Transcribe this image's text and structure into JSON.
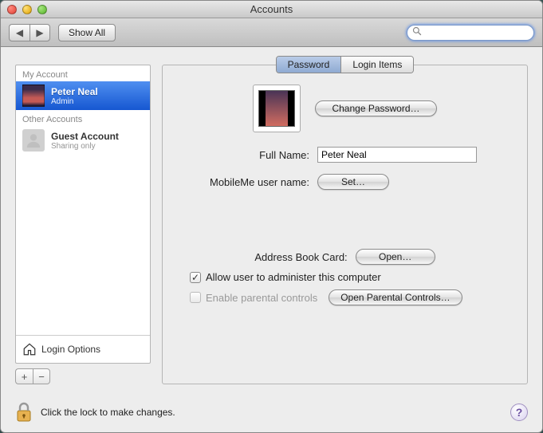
{
  "window": {
    "title": "Accounts"
  },
  "toolbar": {
    "show_all": "Show All",
    "search_placeholder": ""
  },
  "sidebar": {
    "my_account_label": "My Account",
    "other_accounts_label": "Other Accounts",
    "accounts": [
      {
        "name": "Peter Neal",
        "role": "Admin",
        "selected": true
      },
      {
        "name": "Guest Account",
        "role": "Sharing only",
        "selected": false
      }
    ],
    "login_options": "Login Options"
  },
  "tabs": {
    "password": "Password",
    "login_items": "Login Items"
  },
  "main": {
    "change_password": "Change Password…",
    "full_name_label": "Full Name:",
    "full_name_value": "Peter Neal",
    "mobileme_label": "MobileMe user name:",
    "set": "Set…",
    "address_book_label": "Address Book Card:",
    "open": "Open…",
    "admin_check": "Allow user to administer this computer",
    "parental_check": "Enable parental controls",
    "open_parental": "Open Parental Controls…"
  },
  "footer": {
    "lock_text": "Click the lock to make changes."
  }
}
